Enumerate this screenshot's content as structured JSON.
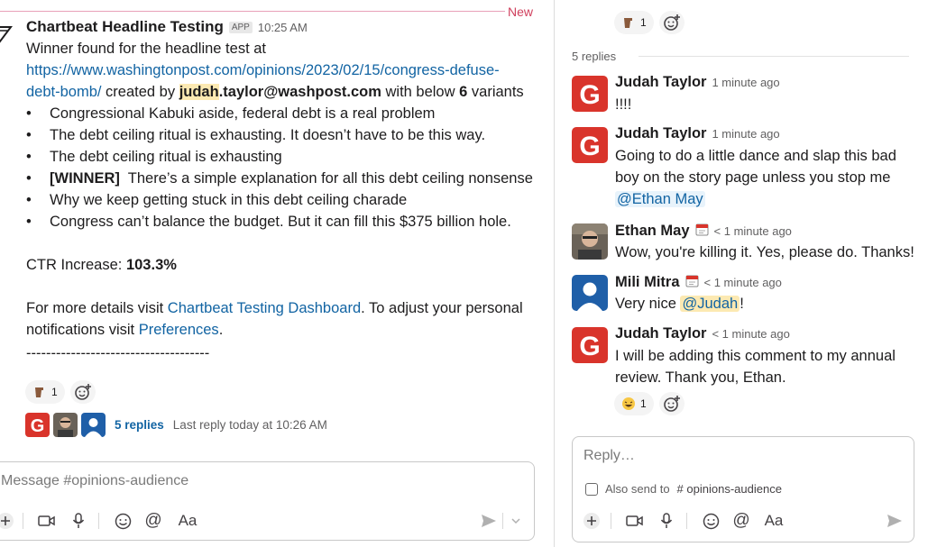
{
  "divider_label": "New",
  "message": {
    "sender": "Chartbeat Headline Testing",
    "badge": "APP",
    "time": "10:25 AM",
    "intro": "Winner found for the headline test at",
    "url_a": "https://www.washingtonpost.com/opinions/2023/02/15/congress-defuse-",
    "url_b": "debt-bomb/",
    "created_by": " created by ",
    "user_hl": "judah",
    "user_rest": ".taylor@washpost.com",
    "with_below": " with below ",
    "count": "6",
    "variants_word": " variants",
    "variants": [
      {
        "winner": "",
        "text": "Congressional Kabuki aside, federal debt is a real problem"
      },
      {
        "winner": "",
        "text": "The debt ceiling ritual is exhausting. It doesn’t have to be this way."
      },
      {
        "winner": "",
        "text": "The debt ceiling ritual is exhausting"
      },
      {
        "winner": "[WINNER]",
        "text": "There’s a simple explanation for all this debt ceiling nonsense"
      },
      {
        "winner": "",
        "text": "Why we keep getting stuck in this debt ceiling charade"
      },
      {
        "winner": "",
        "text": "Congress can’t balance the budget. But it can fill this $375 billion hole."
      }
    ],
    "ctr_label": "CTR Increase: ",
    "ctr_value": "103.3%",
    "details_a": "For more details visit ",
    "details_link": "Chartbeat Testing Dashboard",
    "details_b": ". To adjust your personal",
    "details_c": "notifications visit ",
    "prefs_link": "Preferences",
    "details_d": ".",
    "dashes": "-------------------------------------",
    "reaction_count": "1"
  },
  "thread_summary": {
    "replies": "5 replies",
    "last_reply": "Last reply today at 10:26 AM"
  },
  "composer": {
    "placeholder": "Message #opinions-audience"
  },
  "thread": {
    "top_reaction_count": "1",
    "reply_count": "5 replies",
    "replies": [
      {
        "name": "Judah Taylor",
        "time": "1 minute ago",
        "text": "!!!!"
      },
      {
        "name": "Judah Taylor",
        "time": "1 minute ago",
        "text": "Going to do a little dance and slap this bad boy on the story page unless you stop me ",
        "mention": "@Ethan May"
      },
      {
        "name": "Ethan May",
        "time": "< 1 minute ago",
        "text": "Wow, you're killing it. Yes, please do. Thanks!"
      },
      {
        "name": "Mili Mitra",
        "time": "< 1 minute ago",
        "text": "Very nice ",
        "mention": "@Judah",
        "after": "!"
      },
      {
        "name": "Judah Taylor",
        "time": "< 1 minute ago",
        "text": "I will be adding this comment to my annual review. Thank you, Ethan.",
        "reaction_count": "1"
      }
    ],
    "composer_placeholder": "Reply…",
    "also_send": "Also send to",
    "channel": "opinions-audience"
  },
  "colors": {
    "link": "#1264a3",
    "new_divider": "#d0405d",
    "mention_highlight": "#fce9b2",
    "gazette_red": "#d9342b"
  }
}
